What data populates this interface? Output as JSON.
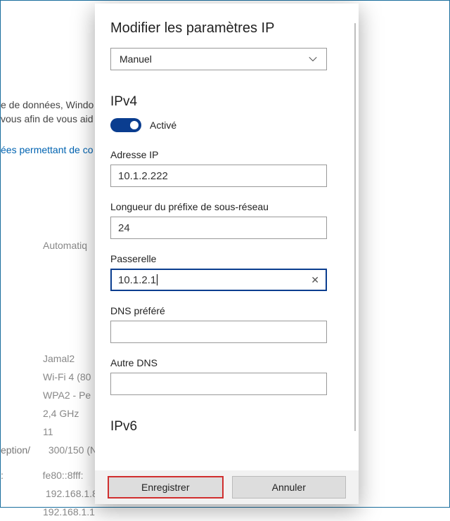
{
  "background": {
    "line1": "e de données, Windo",
    "line2": "vous afin de vous aid",
    "link": "ées permettant de co",
    "auto": "Automatiq",
    "ssid": "Jamal2",
    "proto": "Wi-Fi 4 (80",
    "sec": "WPA2 - Pe",
    "band": "2,4 GHz",
    "chan": "11",
    "rx_label": "eption/",
    "rx": "300/150 (N",
    "addr_label": ":",
    "ip6": "fe80::8fff:",
    "ip4a": "192.168.1.8",
    "ip4b": "192.168.1.1"
  },
  "modal": {
    "title": "Modifier les paramètres IP",
    "mode_select": "Manuel",
    "ipv4_heading": "IPv4",
    "toggle_label": "Activé",
    "fields": {
      "ip_label": "Adresse IP",
      "ip_value": "10.1.2.222",
      "prefix_label": "Longueur du préfixe de sous-réseau",
      "prefix_value": "24",
      "gateway_label": "Passerelle",
      "gateway_value": "10.1.2.1",
      "dns1_label": "DNS préféré",
      "dns1_value": "",
      "dns2_label": "Autre DNS",
      "dns2_value": ""
    },
    "ipv6_heading": "IPv6",
    "save_label": "Enregistrer",
    "cancel_label": "Annuler"
  }
}
